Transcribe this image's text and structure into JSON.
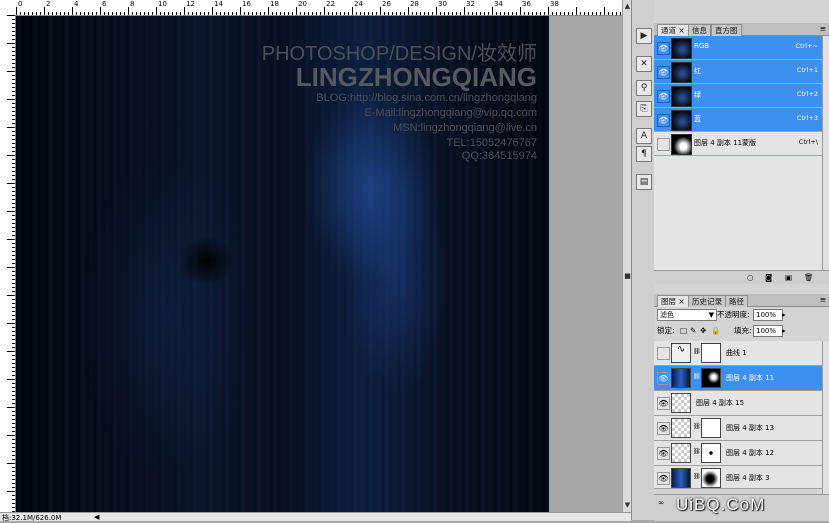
{
  "rulers": {
    "top_labels": [
      "0",
      "2",
      "4",
      "6",
      "8",
      "10",
      "12",
      "14",
      "16",
      "18",
      "20",
      "22",
      "24",
      "26",
      "28",
      "30",
      "32",
      "34",
      "36",
      "38"
    ]
  },
  "watermark": {
    "title": "PHOTOSHOP/DESIGN/妆效师",
    "name": "LINGZHONGQIANG",
    "blog": "BLOG:http://blog.sina.com.cn/lingzhongqiang",
    "email": "E-Mail:lingzhongqiang@vip.qq.com",
    "msn": "MSN:lingzhongqiang@live.cn",
    "tel": "TEL:15052476767",
    "qq": "QQ:364515974"
  },
  "status": {
    "doc_info": "档:32.1M/626.0M"
  },
  "channels_panel": {
    "tabs": [
      "通道",
      "信息",
      "直方图"
    ],
    "rows": [
      {
        "name": "RGB",
        "shortcut": "Ctrl+~",
        "selected": true
      },
      {
        "name": "红",
        "shortcut": "Ctrl+1",
        "selected": true
      },
      {
        "name": "绿",
        "shortcut": "Ctrl+2",
        "selected": true
      },
      {
        "name": "蓝",
        "shortcut": "Ctrl+3",
        "selected": true
      },
      {
        "name": "图层 4 副本 11蒙版",
        "shortcut": "Ctrl+\\",
        "selected": false
      }
    ]
  },
  "layers_panel": {
    "tabs": [
      "图层",
      "历史记录",
      "路径"
    ],
    "blend_mode": "滤色",
    "opacity_label": "不透明度:",
    "opacity_value": "100%",
    "lock_label": "锁定:",
    "fill_label": "填充:",
    "fill_value": "100%",
    "layers": [
      {
        "name": "曲线 1",
        "visible": false,
        "selected": false
      },
      {
        "name": "图层 4 副本 11",
        "visible": true,
        "selected": true
      },
      {
        "name": "图层 4 副本 15",
        "visible": true,
        "selected": false
      },
      {
        "name": "图层 4 副本 13",
        "visible": true,
        "selected": false
      },
      {
        "name": "图层 4 副本 12",
        "visible": true,
        "selected": false
      },
      {
        "name": "图层 4 副本 3",
        "visible": true,
        "selected": false
      }
    ]
  },
  "site_logo": "UiBQ.CoM",
  "colors": {
    "selection_blue": "#3d8ff0",
    "panel_gray": "#d4d4d4",
    "canvas_dark": "#070d1c"
  }
}
